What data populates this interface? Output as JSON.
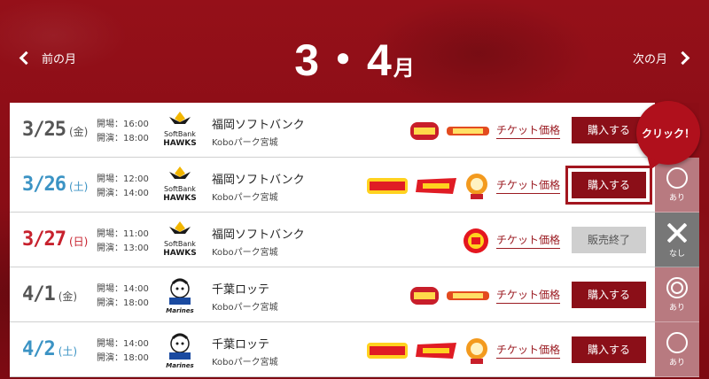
{
  "header": {
    "title_main": "3・4",
    "title_suffix": "月",
    "prev_label": "前の月",
    "next_label": "次の月"
  },
  "callout": {
    "text": "クリック！"
  },
  "games": [
    {
      "date": "3/25",
      "dow": "(金)",
      "date_color": "gray",
      "open": "開場：16:00",
      "start": "開演：18:00",
      "team_logo": "hawks-logo-icon",
      "opponent": "福岡ソフトバンク",
      "venue": "Koboパーク宮城",
      "badges": [
        "event-badge-icon",
        "event-text-badge-icon"
      ],
      "ticket_price": "チケット価格",
      "action": "購入する",
      "sold_out": false,
      "status_mark": "",
      "status_label": ""
    },
    {
      "date": "3/26",
      "dow": "(土)",
      "date_color": "blue",
      "open": "開場：12:00",
      "start": "開演：14:00",
      "team_logo": "hawks-logo-icon",
      "opponent": "福岡ソフトバンク",
      "venue": "Koboパーク宮城",
      "badges": [
        "festival-badge-icon",
        "player-badge-icon",
        "flower-badge-icon"
      ],
      "ticket_price": "チケット価格",
      "action": "購入する",
      "sold_out": false,
      "status_mark": "circle",
      "status_label": "あり"
    },
    {
      "date": "3/27",
      "dow": "(日)",
      "date_color": "red",
      "open": "開場：11:00",
      "start": "開演：13:00",
      "team_logo": "hawks-logo-icon",
      "opponent": "福岡ソフトバンク",
      "venue": "Koboパーク宮城",
      "badges": [
        "round-badge-icon"
      ],
      "ticket_price": "チケット価格",
      "action": "販売終了",
      "sold_out": true,
      "status_mark": "cross",
      "status_label": "なし"
    },
    {
      "date": "4/1",
      "dow": "(金)",
      "date_color": "gray",
      "open": "開場：14:00",
      "start": "開演：18:00",
      "team_logo": "marines-logo-icon",
      "opponent": "千葉ロッテ",
      "venue": "Koboパーク宮城",
      "badges": [
        "event-badge-icon",
        "event-text-badge-icon"
      ],
      "ticket_price": "チケット価格",
      "action": "購入する",
      "sold_out": false,
      "status_mark": "double-circle",
      "status_label": "あり"
    },
    {
      "date": "4/2",
      "dow": "(土)",
      "date_color": "blue",
      "open": "開場：14:00",
      "start": "開演：18:00",
      "team_logo": "marines-logo-icon",
      "opponent": "千葉ロッテ",
      "venue": "Koboパーク宮城",
      "badges": [
        "festival-badge-icon",
        "player-badge-icon",
        "flower-badge-icon"
      ],
      "ticket_price": "チケット価格",
      "action": "購入する",
      "sold_out": false,
      "status_mark": "circle",
      "status_label": "あり"
    }
  ],
  "logo_text": {
    "hawks_line1": "SoftBank",
    "hawks_line2": "HAWKS",
    "marines": "Marines"
  }
}
